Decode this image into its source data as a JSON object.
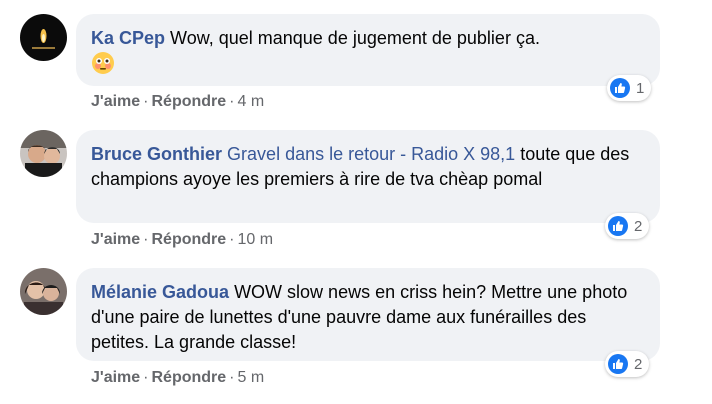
{
  "comments": [
    {
      "author": "Ka CPep",
      "text": "Wow, quel manque de jugement de publier ça.",
      "like_label": "J'aime",
      "reply_label": "Répondre",
      "time": "4 m",
      "reaction_count": "1",
      "emoji": "flushed-face-icon"
    },
    {
      "author": "Bruce Gonthier",
      "tag": "Gravel dans le retour - Radio X 98,1",
      "text": "toute que des champions ayoye les premiers à rire de tva chèap pomal",
      "like_label": "J'aime",
      "reply_label": "Répondre",
      "time": "10 m",
      "reaction_count": "2"
    },
    {
      "author": "Mélanie Gadoua",
      "text": "WOW slow news en criss hein? Mettre une photo d'une paire de lunettes d'une pauvre dame aux funérailles des petites. La grande classe!",
      "like_label": "J'aime",
      "reply_label": "Répondre",
      "time": "5 m",
      "reaction_count": "2"
    }
  ],
  "colors": {
    "author": "#385898",
    "bubble": "#f0f2f5",
    "meta": "#65676b",
    "like_badge": "#1877f2"
  }
}
